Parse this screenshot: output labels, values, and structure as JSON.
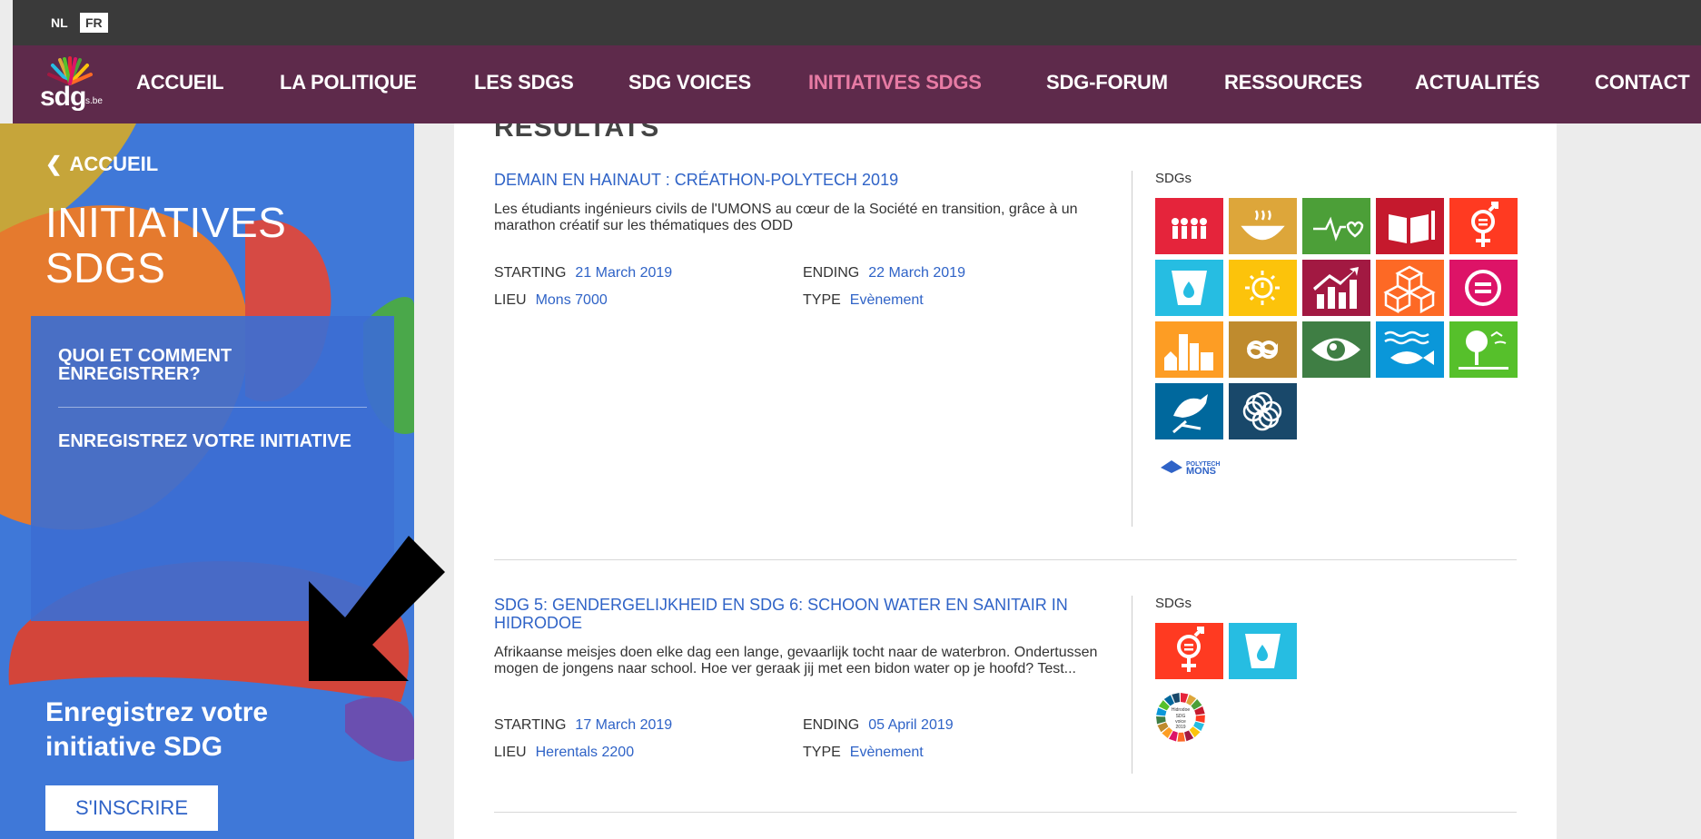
{
  "language_switch": {
    "nl": "NL",
    "fr": "FR"
  },
  "logo": {
    "text": "sdg",
    "suffix": "s.be"
  },
  "nav": {
    "items": [
      "ACCUEIL",
      "LA POLITIQUE",
      "LES SDGS",
      "SDG VOICES",
      "INITIATIVES SDGS",
      "SDG-FORUM",
      "RESSOURCES",
      "ACTUALITÉS",
      "CONTACT"
    ],
    "active_index": 4,
    "active_color": "#e77ba4",
    "background": "#5e2a4b"
  },
  "sidebar": {
    "back_label": "ACCUEIL",
    "title": "INITIATIVES SDGS",
    "menu": [
      "QUOI ET COMMENT ENREGISTRER?",
      "ENREGISTREZ VOTRE INITIATIVE"
    ],
    "cta_title": "Enregistrez votre initiative SDG",
    "cta_button": "S'INSCRIRE"
  },
  "results": {
    "heading": "RÉSULTATS",
    "items": [
      {
        "title": "DEMAIN EN HAINAUT : CRÉATHON-POLYTECH 2019",
        "description": "Les étudiants ingénieurs civils de l'UMONS au cœur de la Société en transition, grâce à un marathon créatif sur les thématiques des ODD",
        "starting_label": "STARTING",
        "starting": "21 March 2019",
        "ending_label": "ENDING",
        "ending": "22 March 2019",
        "lieu_label": "LIEU",
        "lieu": "Mons 7000",
        "type_label": "TYPE",
        "type": "Evènement",
        "sdgs_label": "SDGs",
        "partner_logo": {
          "line1": "POLYTECH",
          "line2": "MONS"
        }
      },
      {
        "title": "SDG 5: GENDERGELIJKHEID EN SDG 6: SCHOON WATER EN SANITAIR IN HIDRODOE",
        "description": "Afrikaanse meisjes doen elke dag een lange, gevaarlijk tocht naar de waterbron. Ondertussen mogen de jongens naar school. Hoe ver geraak jij met een bidon water op je hoofd? Test...",
        "starting_label": "STARTING",
        "starting": "17 March 2019",
        "ending_label": "ENDING",
        "ending": "05 April 2019",
        "lieu_label": "LIEU",
        "lieu": "Herentals 2200",
        "type_label": "TYPE",
        "type": "Evènement",
        "sdgs_label": "SDGs",
        "badge": {
          "line1": "Hidrodoe",
          "line2": "SDG",
          "line3": "voice",
          "line4": "2019"
        }
      }
    ]
  },
  "sdg_tiles": {
    "sdg1": {
      "color": "#e5243b",
      "icon": "family-icon"
    },
    "sdg2": {
      "color": "#dda63a",
      "icon": "bowl-icon"
    },
    "sdg3": {
      "color": "#4c9f38",
      "icon": "heartbeat-icon"
    },
    "sdg4": {
      "color": "#c5192d",
      "icon": "book-icon"
    },
    "sdg5": {
      "color": "#ff3a21",
      "icon": "gender-icon"
    },
    "sdg6": {
      "color": "#26bde2",
      "icon": "water-drop-icon"
    },
    "sdg7": {
      "color": "#fcc30b",
      "icon": "sun-power-icon"
    },
    "sdg8": {
      "color": "#a21942",
      "icon": "growth-chart-icon"
    },
    "sdg9": {
      "color": "#fd6925",
      "icon": "cubes-icon"
    },
    "sdg10": {
      "color": "#dd1367",
      "icon": "equal-icon"
    },
    "sdg11": {
      "color": "#fd9d24",
      "icon": "city-icon"
    },
    "sdg12": {
      "color": "#bf8b2e",
      "icon": "infinity-icon"
    },
    "sdg13": {
      "color": "#3f7e44",
      "icon": "eye-globe-icon"
    },
    "sdg14": {
      "color": "#0a97d9",
      "icon": "fish-icon"
    },
    "sdg15": {
      "color": "#56c02b",
      "icon": "tree-icon"
    },
    "sdg16": {
      "color": "#00689d",
      "icon": "dove-icon"
    },
    "sdg17": {
      "color": "#19486a",
      "icon": "rings-icon"
    }
  },
  "colors": {
    "sidebar_blue": "#3f78d8",
    "link_blue": "#2f63c7",
    "arrow": "#000000"
  }
}
